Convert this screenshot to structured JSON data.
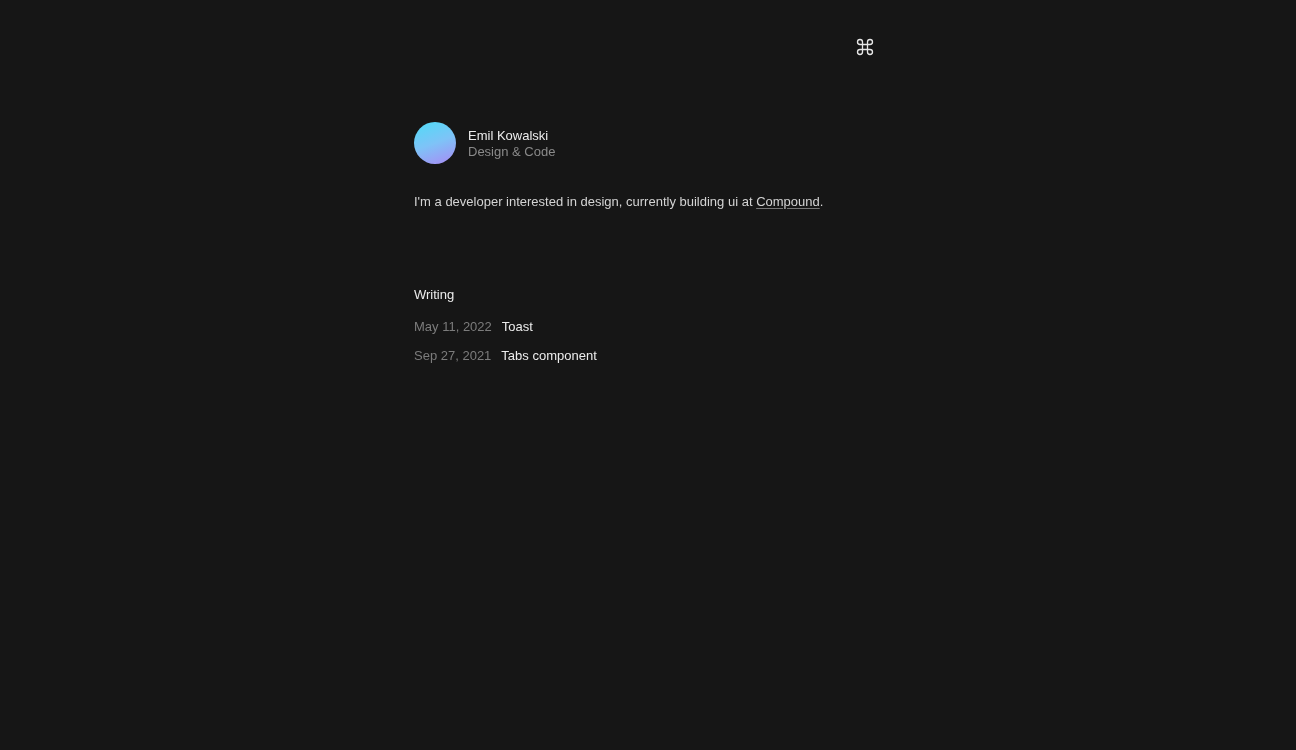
{
  "profile": {
    "name": "Emil Kowalski",
    "role": "Design & Code"
  },
  "bio": {
    "text_before": "I'm a developer interested in design, currently building ui at ",
    "link": "Compound",
    "text_after": "."
  },
  "writing": {
    "heading": "Writing",
    "posts": [
      {
        "date": "May 11, 2022",
        "title": "Toast"
      },
      {
        "date": "Sep 27, 2021",
        "title": "Tabs component"
      }
    ]
  }
}
